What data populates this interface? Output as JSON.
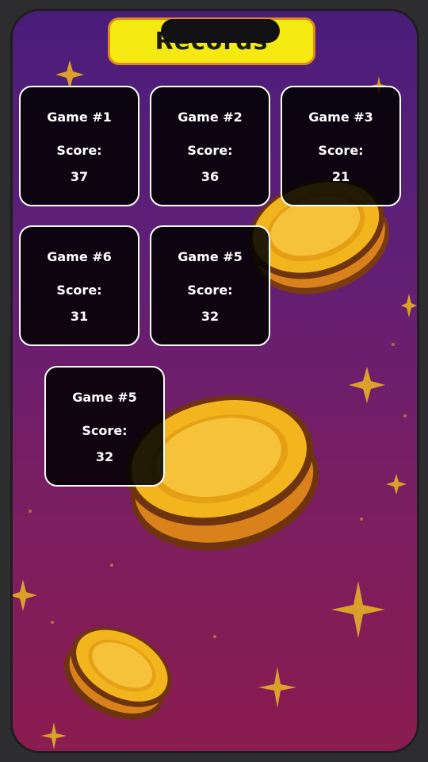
{
  "header": {
    "title": "Records"
  },
  "records": [
    {
      "game_label": "Game #1",
      "score_label": "Score:",
      "score": "37"
    },
    {
      "game_label": "Game #2",
      "score_label": "Score:",
      "score": "36"
    },
    {
      "game_label": "Game #3",
      "score_label": "Score:",
      "score": "21"
    },
    {
      "game_label": "Game #6",
      "score_label": "Score:",
      "score": "31"
    },
    {
      "game_label": "Game #5",
      "score_label": "Score:",
      "score": "32"
    },
    {
      "game_label": "Game #5",
      "score_label": "Score:",
      "score": "32"
    }
  ],
  "colors": {
    "banner": "#f4ea12",
    "banner_border": "#e38a16",
    "card_bg": "#000000",
    "card_border": "#ffffff",
    "coin": "#f5b91c",
    "sparkle": "#e9a92a"
  },
  "icons": [
    "coin-icon",
    "sparkle-icon"
  ]
}
